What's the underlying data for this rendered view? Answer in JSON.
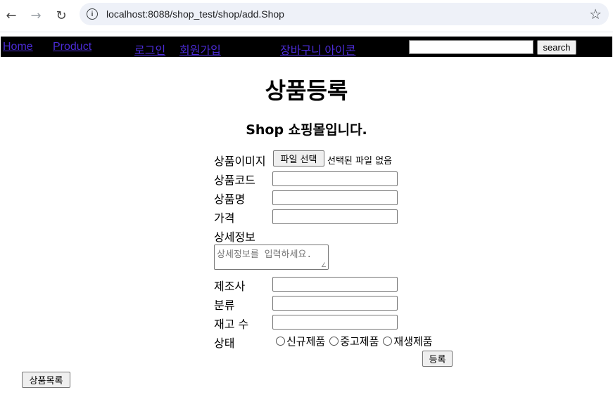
{
  "browser": {
    "url": "localhost:8088/shop_test/shop/add.Shop"
  },
  "navbar": {
    "home": "Home",
    "product": "Product",
    "login": "로그인",
    "signup": "회원가입",
    "cart": "장바구니 아이콘",
    "search_value": "",
    "search_button": "search"
  },
  "page": {
    "title": "상품등록",
    "subtitle": "Shop 쇼핑몰입니다."
  },
  "form": {
    "image_label": "상품이미지",
    "file_button": "파일 선택",
    "file_status": "선택된 파일 없음",
    "code_label": "상품코드",
    "code_value": "",
    "name_label": "상품명",
    "name_value": "",
    "price_label": "가격",
    "price_value": "",
    "detail_label": "상세정보",
    "detail_placeholder": "상세정보를 입력하세요.",
    "maker_label": "제조사",
    "maker_value": "",
    "category_label": "분류",
    "category_value": "",
    "stock_label": "재고 수",
    "stock_value": "",
    "condition_label": "상태",
    "condition_options": [
      "신규제품",
      "중고제품",
      "재생제품"
    ],
    "submit_button": "등록",
    "list_button": "상품목록"
  }
}
